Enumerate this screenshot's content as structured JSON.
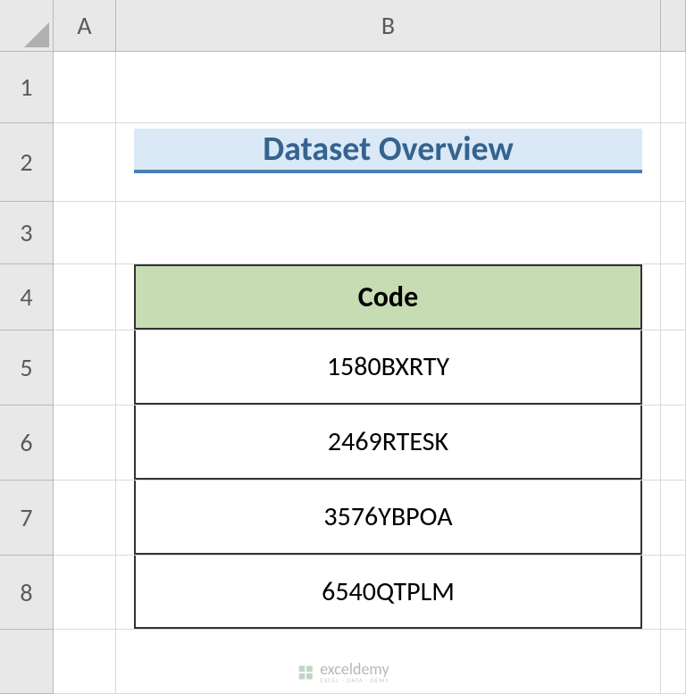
{
  "columns": {
    "A": "A",
    "B": "B"
  },
  "rows": {
    "1": "1",
    "2": "2",
    "3": "3",
    "4": "4",
    "5": "5",
    "6": "6",
    "7": "7",
    "8": "8"
  },
  "title": "Dataset Overview",
  "table": {
    "header": "Code",
    "data": [
      "1580BXRTY",
      "2469RTESK",
      "3576YBPOA",
      "6540QTPLM"
    ]
  },
  "watermark": {
    "brand": "exceldemy",
    "tagline": "EXCEL · DATA · DEMY"
  }
}
